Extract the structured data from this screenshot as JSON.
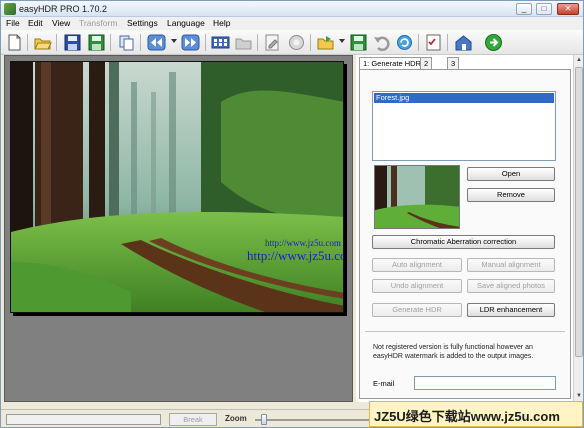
{
  "window": {
    "title": "easyHDR PRO 1.70.2",
    "controls": [
      "_",
      "□",
      "✕"
    ]
  },
  "menu": [
    {
      "label": "File",
      "enabled": true
    },
    {
      "label": "Edit",
      "enabled": true
    },
    {
      "label": "View",
      "enabled": true
    },
    {
      "label": "Transform",
      "enabled": false
    },
    {
      "label": "Settings",
      "enabled": true
    },
    {
      "label": "Language",
      "enabled": true
    },
    {
      "label": "Help",
      "enabled": true
    }
  ],
  "toolbar": {
    "icons": [
      "new-document-icon",
      "open-folder-icon",
      "save-icon",
      "save-as-icon",
      "copy-icon",
      "rewind-icon",
      "forward-icon",
      "film-icon",
      "folder-disabled-icon",
      "edit-icon",
      "circle-icon",
      "export-folder-icon",
      "save-green-icon",
      "undo-icon",
      "refresh-icon",
      "checklist-icon",
      "home-icon",
      "go-icon"
    ]
  },
  "image": {
    "watermark_line1": "http://www.jz5u.com",
    "watermark_line2": "http://www.jz5u.com"
  },
  "panel": {
    "tabs": [
      "1: Generate HDR",
      "2",
      "3"
    ],
    "active_tab": 0,
    "file_list": [
      "Forest.jpg"
    ],
    "buttons": {
      "open": "Open",
      "remove": "Remove",
      "chromatic": "Chromatic Aberration correction",
      "auto_alignment": "Auto alignment",
      "manual_alignment": "Manual alignment",
      "undo_alignment": "Undo alignment",
      "save_aligned": "Save aligned photos",
      "generate_hdr": "Generate HDR",
      "ldr_enhancement": "LDR enhancement"
    },
    "notice": "Not registered version is fully functional however an easyHDR watermark is added to the output images.",
    "email_label": "E-mail"
  },
  "status": {
    "progress": 0,
    "break_label": "Break",
    "zoom_label": "Zoom",
    "zoom_level": 0.05
  },
  "badge": {
    "text": "JZ5U绿色下载站www.jz5u.com"
  }
}
